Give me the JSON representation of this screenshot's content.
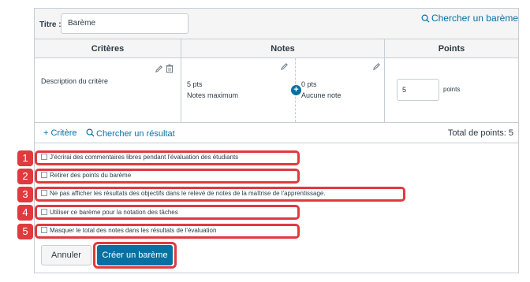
{
  "form": {
    "title_label": "Titre :",
    "title_value": "Barème",
    "find_rubric_label": "Chercher un barème"
  },
  "table": {
    "headers": {
      "criteria": "Critères",
      "notes": "Notes",
      "points": "Points"
    },
    "row": {
      "criterion_description": "Description du critère",
      "ratings": [
        {
          "points": "5 pts",
          "description": "Notes maximum"
        },
        {
          "points": "0 pts",
          "description": "Aucune note"
        }
      ],
      "points_value": "5",
      "points_unit": "points"
    }
  },
  "footer": {
    "add_criterion_label": "Critère",
    "add_criterion_icon": "plus-icon",
    "find_outcome_label": "Chercher un résultat",
    "total_points": "Total de points: 5"
  },
  "options": [
    {
      "number": "1",
      "label": "J'écrirai des commentaires libres pendant l'évaluation des étudiants",
      "checked": false
    },
    {
      "number": "2",
      "label": "Retirer des points du barème",
      "checked": false
    },
    {
      "number": "3",
      "label": "Ne pas afficher les résultats des objectifs dans le relevé de notes de la maîtrise de l'apprentissage.",
      "checked": false
    },
    {
      "number": "4",
      "label": "Utiliser ce barème pour la notation des tâches",
      "checked": false
    },
    {
      "number": "5",
      "label": "Masquer le total des notes dans les résultats de l'évaluation",
      "checked": false
    }
  ],
  "buttons": {
    "cancel": "Annuler",
    "create": "Créer un barème"
  },
  "colors": {
    "accent": "#0770a3",
    "highlight": "#e03a3f"
  }
}
